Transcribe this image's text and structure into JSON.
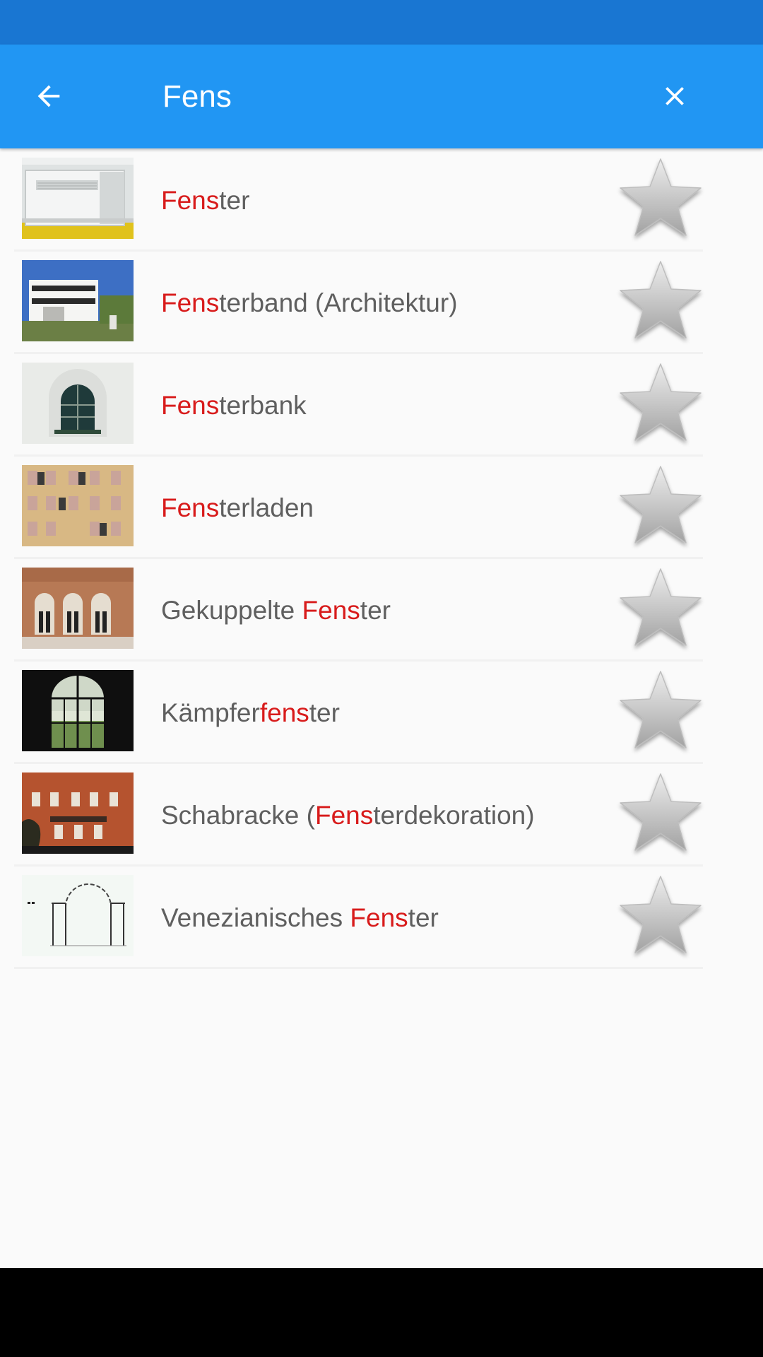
{
  "search": {
    "value": "Fens",
    "placeholder": ""
  },
  "icons": {
    "back": "arrow-back-icon",
    "clear": "close-icon",
    "favorite": "star-outline-icon"
  },
  "colors": {
    "status_bar": "#1976d2",
    "app_bar": "#2196f3",
    "highlight": "#d81b1b",
    "text": "#5f5f5f"
  },
  "results": [
    {
      "pre": "",
      "hl": "Fens",
      "post": "ter",
      "thumb": "window-ac-unit"
    },
    {
      "pre": "",
      "hl": "Fens",
      "post": "terband (Architektur)",
      "thumb": "modern-building"
    },
    {
      "pre": "",
      "hl": "Fens",
      "post": "terbank",
      "thumb": "arched-window"
    },
    {
      "pre": "",
      "hl": "Fens",
      "post": "terladen",
      "thumb": "shuttered-facade"
    },
    {
      "pre": "Gekuppelte ",
      "hl": "Fens",
      "post": "ter",
      "thumb": "gothic-windows"
    },
    {
      "pre": "Kämpfer",
      "hl": "fens",
      "post": "ter",
      "thumb": "transom-window"
    },
    {
      "pre": "Schabracke (",
      "hl": "Fens",
      "post": "terdekoration)",
      "thumb": "brick-building"
    },
    {
      "pre": "Venezianisches ",
      "hl": "Fens",
      "post": "ter",
      "thumb": "venetian-window-drawing"
    }
  ]
}
